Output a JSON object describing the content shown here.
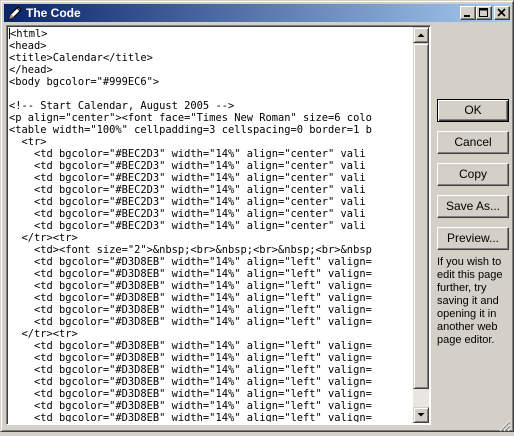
{
  "window": {
    "title": "The Code",
    "icon": "pen-icon",
    "controls": [
      "minimize-icon",
      "maximize-icon",
      "close-icon"
    ]
  },
  "code_lines": [
    "<html>",
    "<head>",
    "<title>Calendar</title>",
    "</head>",
    "<body bgcolor=\"#999EC6\">",
    "",
    "<!-- Start Calendar, August 2005 -->",
    "<p align=\"center\"><font face=\"Times New Roman\" size=6 colo",
    "<table width=\"100%\" cellpadding=3 cellspacing=0 border=1 b",
    "  <tr>",
    "    <td bgcolor=\"#BEC2D3\" width=\"14%\" align=\"center\" vali",
    "    <td bgcolor=\"#BEC2D3\" width=\"14%\" align=\"center\" vali",
    "    <td bgcolor=\"#BEC2D3\" width=\"14%\" align=\"center\" vali",
    "    <td bgcolor=\"#BEC2D3\" width=\"14%\" align=\"center\" vali",
    "    <td bgcolor=\"#BEC2D3\" width=\"14%\" align=\"center\" vali",
    "    <td bgcolor=\"#BEC2D3\" width=\"14%\" align=\"center\" vali",
    "    <td bgcolor=\"#BEC2D3\" width=\"14%\" align=\"center\" vali",
    "  </tr><tr>",
    "    <td><font size=\"2\">&nbsp;<br>&nbsp;<br>&nbsp;<br>&nbsp",
    "    <td bgcolor=\"#D3D8EB\" width=\"14%\" align=\"left\" valign=",
    "    <td bgcolor=\"#D3D8EB\" width=\"14%\" align=\"left\" valign=",
    "    <td bgcolor=\"#D3D8EB\" width=\"14%\" align=\"left\" valign=",
    "    <td bgcolor=\"#D3D8EB\" width=\"14%\" align=\"left\" valign=",
    "    <td bgcolor=\"#D3D8EB\" width=\"14%\" align=\"left\" valign=",
    "    <td bgcolor=\"#D3D8EB\" width=\"14%\" align=\"left\" valign=",
    "  </tr><tr>",
    "    <td bgcolor=\"#D3D8EB\" width=\"14%\" align=\"left\" valign=",
    "    <td bgcolor=\"#D3D8EB\" width=\"14%\" align=\"left\" valign=",
    "    <td bgcolor=\"#D3D8EB\" width=\"14%\" align=\"left\" valign=",
    "    <td bgcolor=\"#D3D8EB\" width=\"14%\" align=\"left\" valign=",
    "    <td bgcolor=\"#D3D8EB\" width=\"14%\" align=\"left\" valign=",
    "    <td bgcolor=\"#D3D8EB\" width=\"14%\" align=\"left\" valign=",
    "    <td bgcolor=\"#D3D8EB\" width=\"14%\" align=\"left\" valign="
  ],
  "buttons": {
    "ok": "OK",
    "cancel": "Cancel",
    "copy": "Copy",
    "save_as": "Save As...",
    "preview": "Preview..."
  },
  "hint": "If you wish to edit this page further, try saving it and opening it in another web page editor.",
  "colors": {
    "titlebar_start": "#0a246a",
    "titlebar_end": "#a6caf0",
    "face": "#d4d0c8"
  }
}
